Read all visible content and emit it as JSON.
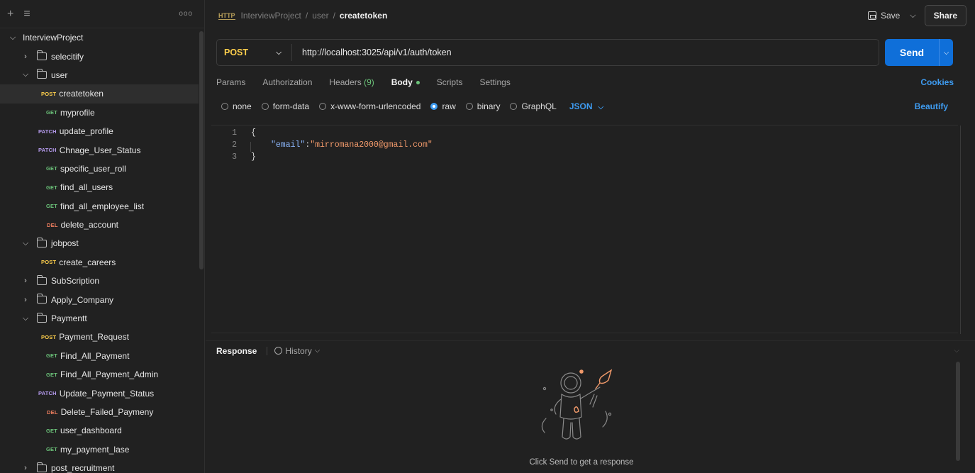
{
  "sidebar": {
    "new_icon": "+",
    "filter_icon": "≡",
    "more_icon": "ooo",
    "items": [
      {
        "kind": "folder",
        "open": true,
        "level": 0,
        "label": "InterviewProject"
      },
      {
        "kind": "folder",
        "open": false,
        "level": 1,
        "label": "selecitify"
      },
      {
        "kind": "folder",
        "open": true,
        "level": 1,
        "label": "user"
      },
      {
        "kind": "request",
        "level": 2,
        "method": "POST",
        "label": "createtoken",
        "selected": true
      },
      {
        "kind": "request",
        "level": 2,
        "method": "GET",
        "label": "myprofile"
      },
      {
        "kind": "request",
        "level": 2,
        "method": "PATCH",
        "label": "update_profile"
      },
      {
        "kind": "request",
        "level": 2,
        "method": "PATCH",
        "label": "Chnage_User_Status"
      },
      {
        "kind": "request",
        "level": 2,
        "method": "GET",
        "label": "specific_user_roll"
      },
      {
        "kind": "request",
        "level": 2,
        "method": "GET",
        "label": "find_all_users"
      },
      {
        "kind": "request",
        "level": 2,
        "method": "GET",
        "label": "find_all_employee_list"
      },
      {
        "kind": "request",
        "level": 2,
        "method": "DEL",
        "label": "delete_account"
      },
      {
        "kind": "folder",
        "open": true,
        "level": 1,
        "label": "jobpost"
      },
      {
        "kind": "request",
        "level": 2,
        "method": "POST",
        "label": "create_careers"
      },
      {
        "kind": "folder",
        "open": false,
        "level": 1,
        "label": "SubScription"
      },
      {
        "kind": "folder",
        "open": false,
        "level": 1,
        "label": "Apply_Company"
      },
      {
        "kind": "folder",
        "open": true,
        "level": 1,
        "label": "Paymentt"
      },
      {
        "kind": "request",
        "level": 2,
        "method": "POST",
        "label": "Payment_Request"
      },
      {
        "kind": "request",
        "level": 2,
        "method": "GET",
        "label": "Find_All_Payment"
      },
      {
        "kind": "request",
        "level": 2,
        "method": "GET",
        "label": "Find_All_Payment_Admin"
      },
      {
        "kind": "request",
        "level": 2,
        "method": "PATCH",
        "label": "Update_Payment_Status"
      },
      {
        "kind": "request",
        "level": 2,
        "method": "DEL",
        "label": "Delete_Failed_Paymeny"
      },
      {
        "kind": "request",
        "level": 2,
        "method": "GET",
        "label": "user_dashboard"
      },
      {
        "kind": "request",
        "level": 2,
        "method": "GET",
        "label": "my_payment_lase"
      },
      {
        "kind": "folder",
        "open": false,
        "level": 1,
        "label": "post_recruitment"
      }
    ]
  },
  "header": {
    "protocol_icon": "HTTP",
    "breadcrumb": [
      "InterviewProject",
      "user"
    ],
    "separator": "/",
    "current": "createtoken",
    "save_label": "Save",
    "share_label": "Share"
  },
  "request": {
    "method": "POST",
    "url": "http://localhost:3025/api/v1/auth/token",
    "send_label": "Send"
  },
  "tabs": {
    "params": "Params",
    "authorization": "Authorization",
    "headers": "Headers",
    "headers_count": "(9)",
    "body": "Body",
    "scripts": "Scripts",
    "settings": "Settings",
    "cookies": "Cookies"
  },
  "body_options": {
    "none": "none",
    "form_data": "form-data",
    "urlencoded": "x-www-form-urlencoded",
    "raw": "raw",
    "binary": "binary",
    "graphql": "GraphQL",
    "format": "JSON",
    "beautify": "Beautify"
  },
  "editor": {
    "line_numbers": [
      "1",
      "2",
      "3"
    ],
    "open_brace": "{",
    "key": "\"email\"",
    "colon": ":",
    "value": "\"mirromana2000@gmail.com\"",
    "close_brace": "}"
  },
  "response": {
    "label": "Response",
    "history_label": "History",
    "hint": "Click Send to get a response"
  },
  "colors": {
    "accent": "#0f6fd9",
    "link": "#3e9bf0",
    "post": "#ffd04c",
    "get": "#6cc47a",
    "patch": "#b79cf0",
    "delete": "#f07f5f",
    "illustration": "#f0996a"
  }
}
